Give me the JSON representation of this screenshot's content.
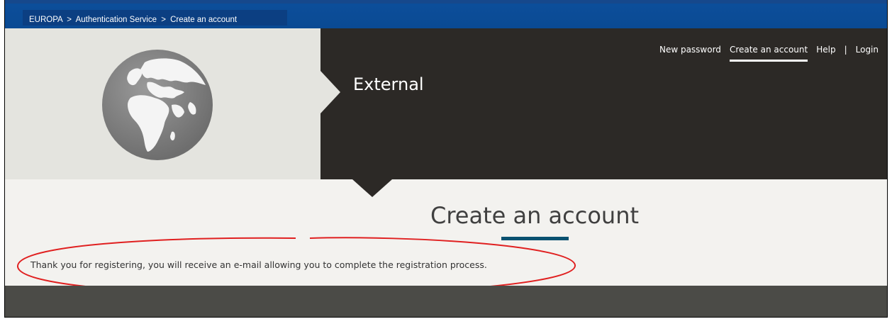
{
  "breadcrumb": {
    "items": [
      "EUROPA",
      "Authentication Service",
      "Create an account"
    ],
    "separator": ">"
  },
  "header": {
    "site_name": "External"
  },
  "nav": {
    "new_password": "New password",
    "create_account": "Create an account",
    "help": "Help",
    "separator": "|",
    "login": "Login"
  },
  "main": {
    "title": "Create an account",
    "message": "Thank you for registering, you will receive an e-mail allowing you to complete the registration process."
  },
  "colors": {
    "breadcrumb_bar": "#0c4e9a",
    "header_dark": "#2c2926",
    "header_light": "#e4e4df",
    "accent_underline": "#0a5170",
    "annotation_ellipse": "#e02020",
    "footer": "#4b4b47"
  },
  "icons": {
    "logo": "globe-icon"
  }
}
